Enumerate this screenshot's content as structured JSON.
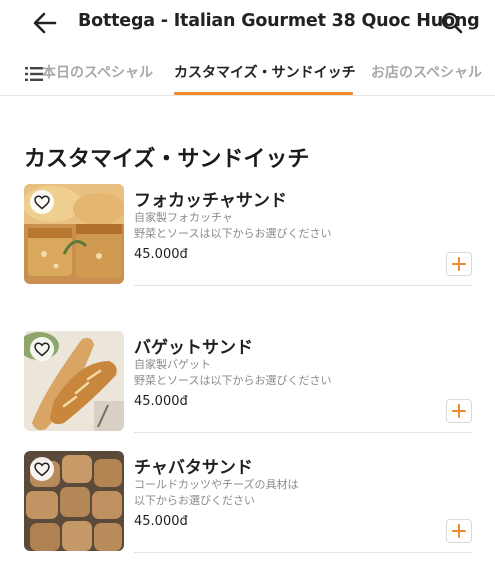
{
  "header": {
    "title": "Bottega - Italian Gourmet 38 Quoc Huong",
    "back_icon": "arrow-left-icon",
    "search_icon": "search-icon"
  },
  "tabs": [
    {
      "label": "本日のスペシャル",
      "active": false
    },
    {
      "label": "カスタマイズ・サンドイッチ",
      "active": true
    },
    {
      "label": "お店のスペシャル",
      "active": false
    }
  ],
  "accent_color": "#ee8a2b",
  "section": {
    "title": "カスタマイズ・サンドイッチ"
  },
  "items": [
    {
      "name": "フォカッチャサンド",
      "desc_lines": [
        "自家製フォカッチャ",
        "野菜とソースは以下からお選びください"
      ],
      "price": "45.000đ"
    },
    {
      "name": "バゲットサンド",
      "desc_lines": [
        "自家製バゲット",
        "野菜とソースは以下からお選びください"
      ],
      "price": "45.000đ"
    },
    {
      "name": "チャバタサンド",
      "desc_lines": [
        "コールドカッツやチーズの具材は",
        "以下からお選びください"
      ],
      "price": "45.000đ"
    }
  ]
}
